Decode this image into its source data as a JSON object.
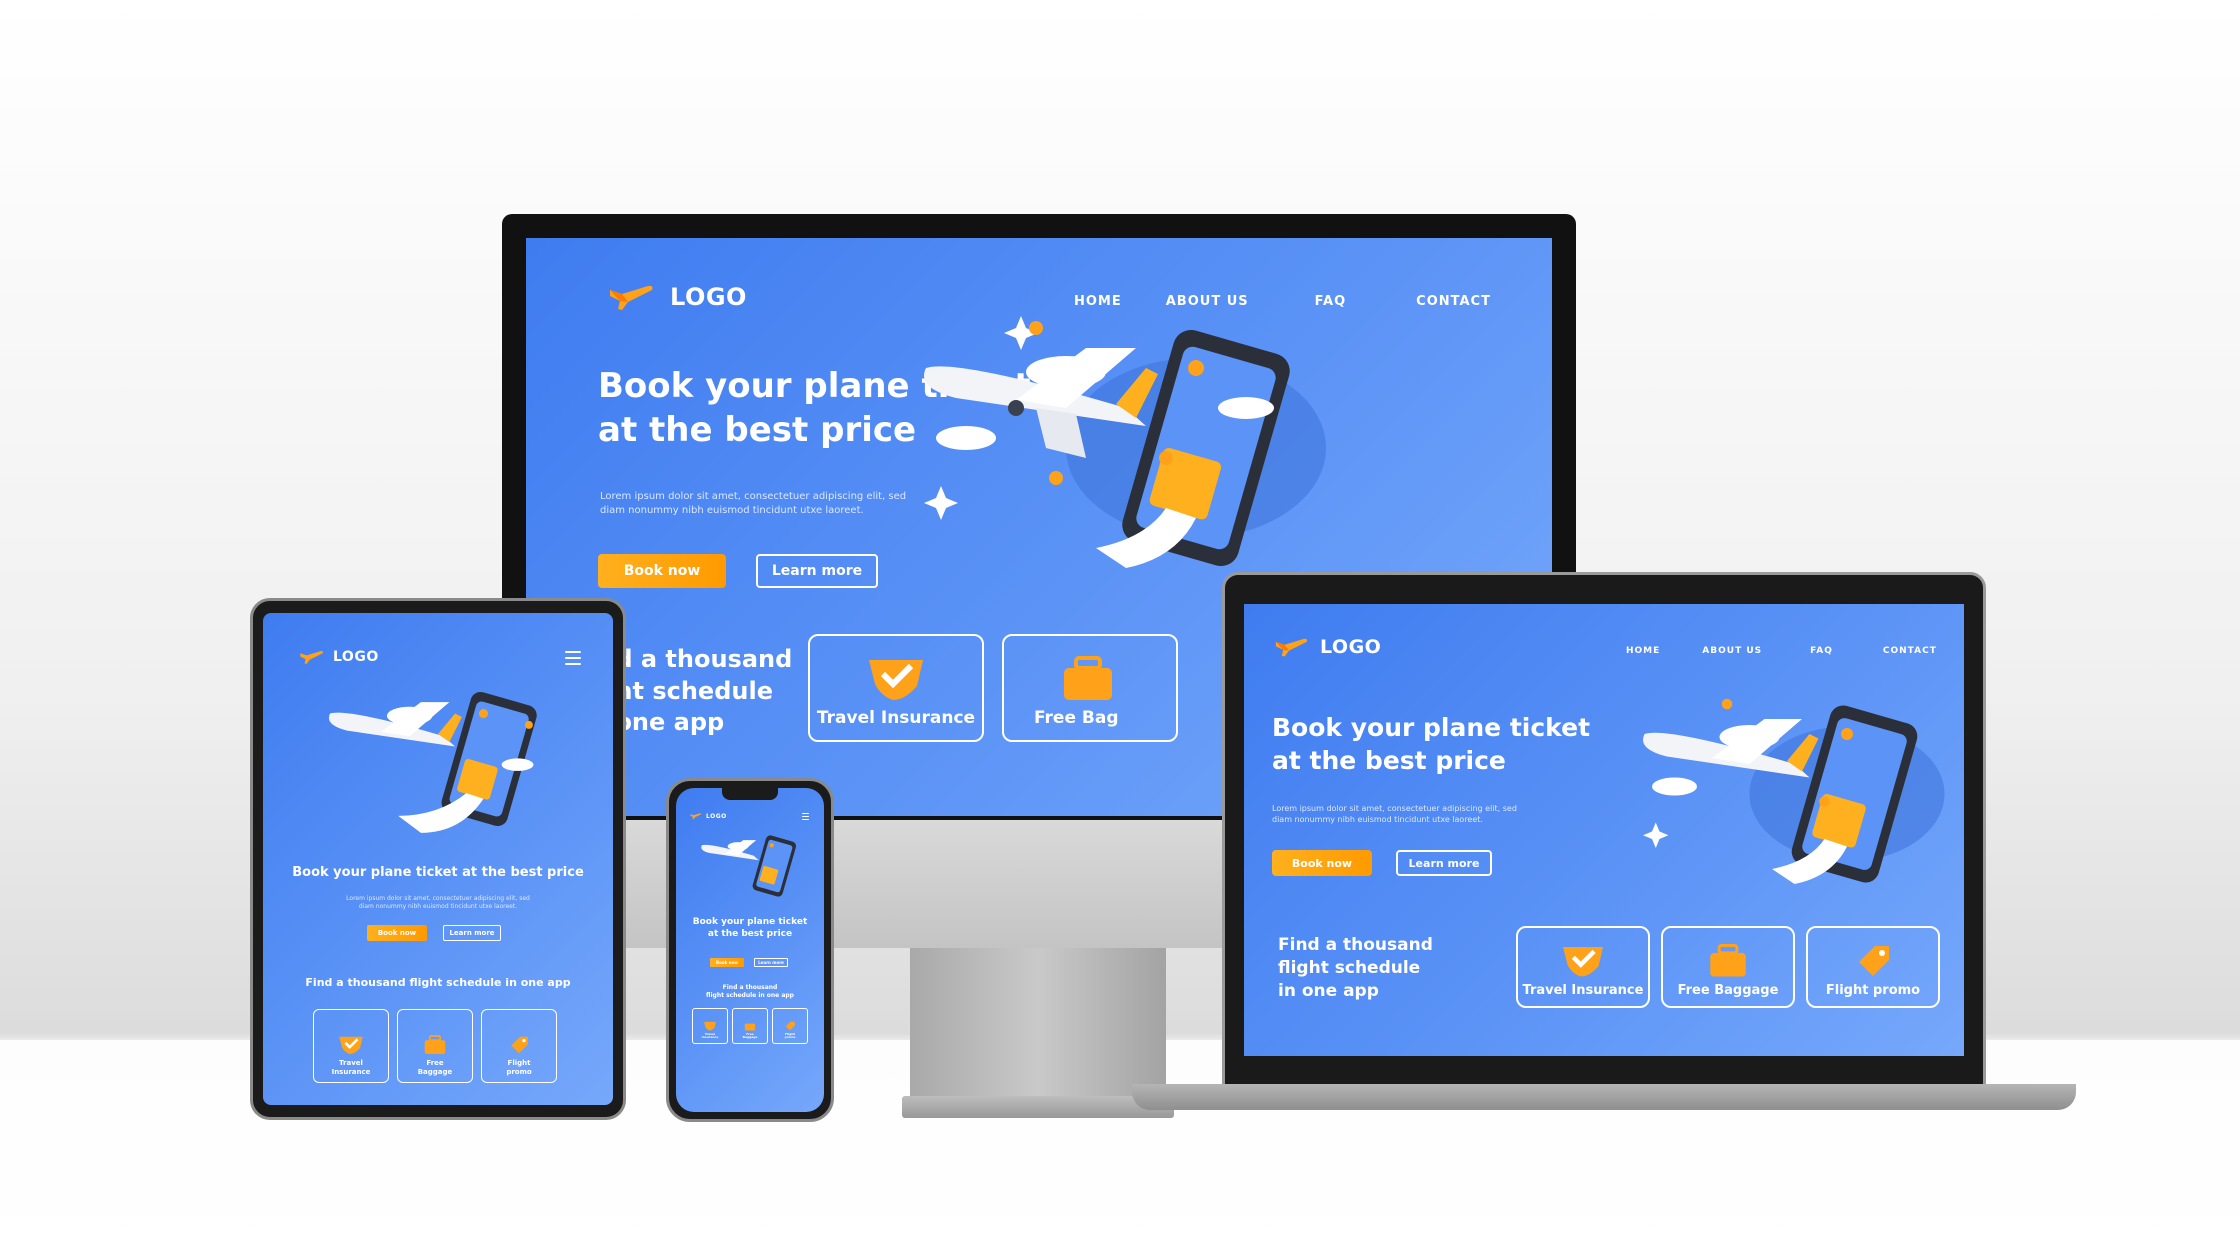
{
  "site": {
    "logo_text": "LOGO",
    "nav": [
      "HOME",
      "ABOUT US",
      "FAQ",
      "CONTACT"
    ],
    "headline_line1": "Book your plane ticket",
    "headline_line2": "at the best price",
    "headline_single": "Book your plane ticket at the best price",
    "lorem_line1": "Lorem ipsum dolor sit amet, consectetuer adipiscing elit, sed",
    "lorem_line2": "diam nonummy nibh euismod tincidunt utxe laoreet.",
    "book_label": "Book now",
    "learn_label": "Learn more",
    "find_line1": "Find a thousand",
    "find_line2": "flight schedule",
    "find_line3": "in one app",
    "find_single": "Find a thousand flight schedule in one app",
    "monitor_find_line1": "ind a thousand",
    "monitor_find_line2": "ight schedule",
    "monitor_find_line3": "n one app",
    "features": [
      {
        "label": "Travel Insurance",
        "short_line1": "Travel",
        "short_line2": "Insurance",
        "icon": "shield-check-icon"
      },
      {
        "label": "Free Baggage",
        "short_line1": "Free",
        "short_line2": "Baggage",
        "icon": "suitcase-icon"
      },
      {
        "label": "Flight promo",
        "short_line1": "Flight",
        "short_line2": "promo",
        "icon": "tag-icon"
      }
    ],
    "monitor_cut_feature": "Free Bag"
  },
  "colors": {
    "screen_blue": "#4a86f3",
    "accent_orange": "#ff9f0a",
    "white": "#ffffff"
  }
}
